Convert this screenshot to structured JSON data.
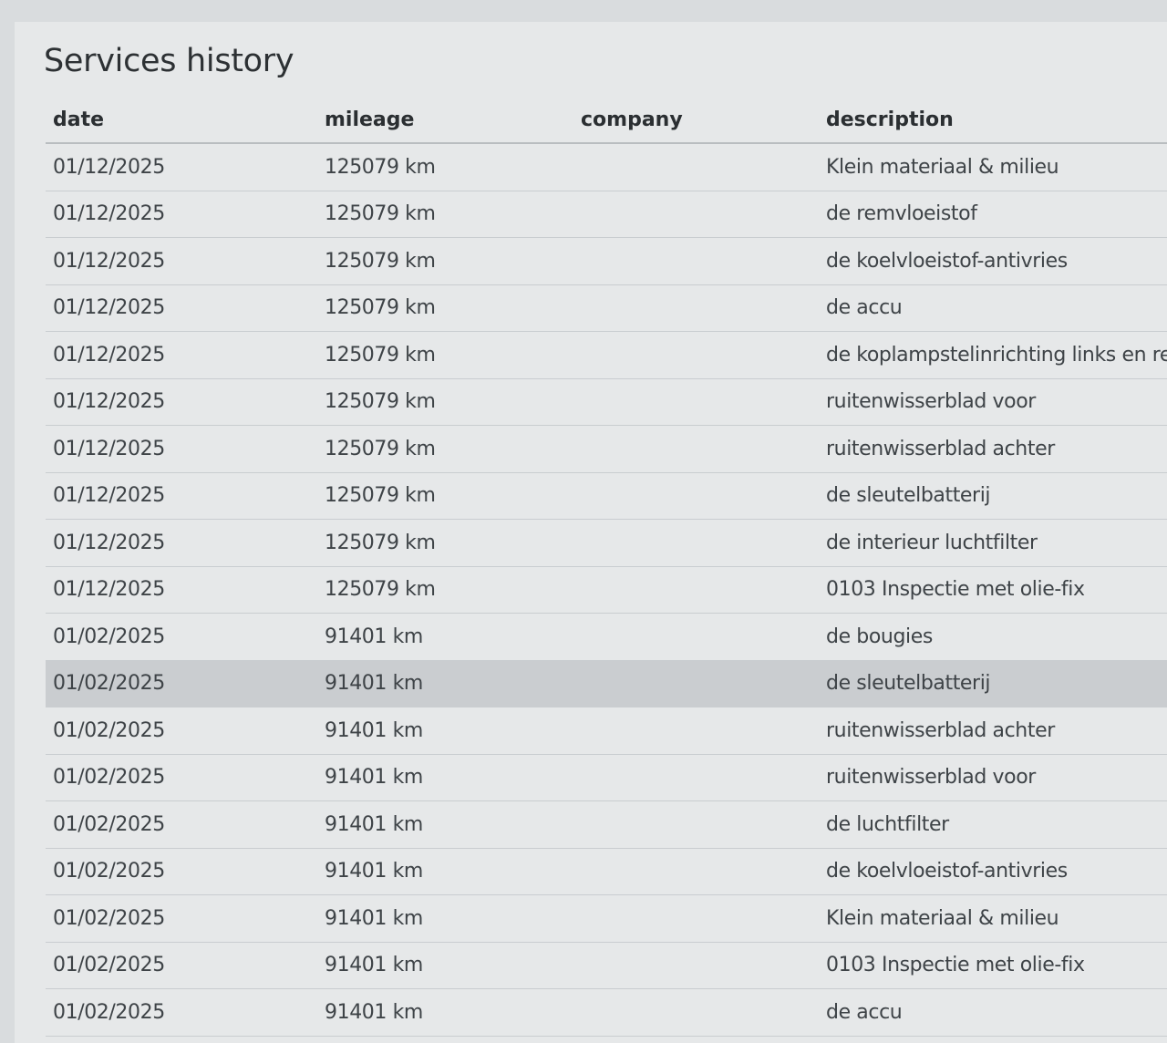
{
  "page": {
    "title": "Services history"
  },
  "table": {
    "headers": {
      "date": "date",
      "mileage": "mileage",
      "company": "company",
      "description": "description"
    },
    "highlighted_row_index": 11,
    "rows": [
      {
        "date": "01/12/2025",
        "mileage": "125079 km",
        "company": "",
        "description": "Klein materiaal & milieu"
      },
      {
        "date": "01/12/2025",
        "mileage": "125079 km",
        "company": "",
        "description": "de remvloeistof"
      },
      {
        "date": "01/12/2025",
        "mileage": "125079 km",
        "company": "",
        "description": "de koelvloeistof-antivries"
      },
      {
        "date": "01/12/2025",
        "mileage": "125079 km",
        "company": "",
        "description": "de accu"
      },
      {
        "date": "01/12/2025",
        "mileage": "125079 km",
        "company": "",
        "description": "de koplampstelinrichting links en rechts"
      },
      {
        "date": "01/12/2025",
        "mileage": "125079 km",
        "company": "",
        "description": "ruitenwisserblad voor"
      },
      {
        "date": "01/12/2025",
        "mileage": "125079 km",
        "company": "",
        "description": "ruitenwisserblad achter"
      },
      {
        "date": "01/12/2025",
        "mileage": "125079 km",
        "company": "",
        "description": "de sleutelbatterij"
      },
      {
        "date": "01/12/2025",
        "mileage": "125079 km",
        "company": "",
        "description": "de interieur luchtfilter"
      },
      {
        "date": "01/12/2025",
        "mileage": "125079 km",
        "company": "",
        "description": "0103 Inspectie met olie-fix"
      },
      {
        "date": "01/02/2025",
        "mileage": "91401 km",
        "company": "",
        "description": "de bougies"
      },
      {
        "date": "01/02/2025",
        "mileage": "91401 km",
        "company": "",
        "description": "de sleutelbatterij"
      },
      {
        "date": "01/02/2025",
        "mileage": "91401 km",
        "company": "",
        "description": "ruitenwisserblad achter"
      },
      {
        "date": "01/02/2025",
        "mileage": "91401 km",
        "company": "",
        "description": "ruitenwisserblad voor"
      },
      {
        "date": "01/02/2025",
        "mileage": "91401 km",
        "company": "",
        "description": "de luchtfilter"
      },
      {
        "date": "01/02/2025",
        "mileage": "91401 km",
        "company": "",
        "description": "de koelvloeistof-antivries"
      },
      {
        "date": "01/02/2025",
        "mileage": "91401 km",
        "company": "",
        "description": "Klein materiaal & milieu"
      },
      {
        "date": "01/02/2025",
        "mileage": "91401 km",
        "company": "",
        "description": "0103 Inspectie met olie-fix"
      },
      {
        "date": "01/02/2025",
        "mileage": "91401 km",
        "company": "",
        "description": "de accu"
      }
    ]
  }
}
